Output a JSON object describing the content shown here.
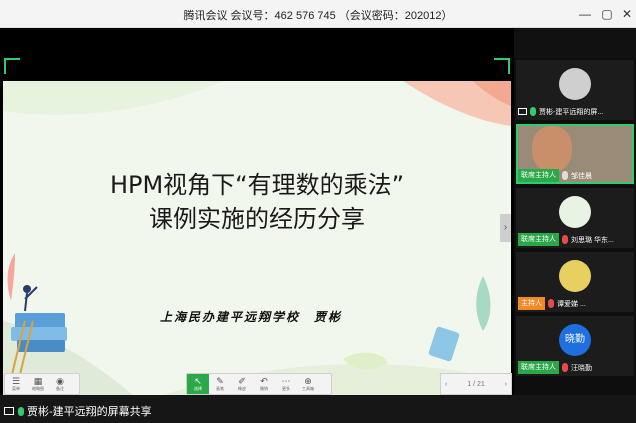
{
  "window": {
    "title": "腾讯会议 会议号：462 576 745 （会议密码：202012）",
    "controls": [
      "minimize-icon",
      "restore-icon",
      "close-icon"
    ]
  },
  "slide": {
    "title_line1": "HPM视角下“有理数的乘法”",
    "title_line2": "课例实施的经历分享",
    "author": "上海民办建平远翔学校　贾彬"
  },
  "toolbar_left": [
    {
      "icon": "menu-icon",
      "label": "菜单"
    },
    {
      "icon": "thumbnail-icon",
      "label": "缩略图"
    },
    {
      "icon": "notes-icon",
      "label": "备注"
    }
  ],
  "toolbar_center": [
    {
      "icon": "select-icon",
      "label": "选择",
      "active": true
    },
    {
      "icon": "pen-icon",
      "label": "画笔",
      "active": false
    },
    {
      "icon": "eraser-icon",
      "label": "橡皮",
      "active": false
    },
    {
      "icon": "undo-icon",
      "label": "撤销",
      "active": false
    },
    {
      "icon": "more-icon",
      "label": "更多",
      "active": false
    },
    {
      "icon": "tools-icon",
      "label": "工具箱",
      "active": false
    }
  ],
  "pager": {
    "prev": "‹",
    "text": "1 / 21",
    "next": "›"
  },
  "participants": [
    {
      "name": "贾彬-建平远翔的屏...",
      "role": "",
      "avatar_color": "#cfcfcf",
      "active": false
    },
    {
      "name": "邹佳晨",
      "role": "联席主持人",
      "avatar_color": "#7a5a3a",
      "active": true
    },
    {
      "name": "刘思璐 华东...",
      "role": "联席主持人",
      "avatar_color": "#e8f3e4",
      "active": false
    },
    {
      "name": "谭爱娣 ...",
      "role": "主持人",
      "role_color": "orange",
      "avatar_color": "#e8d060",
      "active": false
    },
    {
      "name": "汪晓勤",
      "role": "联席主持人",
      "avatar_text": "晓勤",
      "avatar_color": "#1e6fe0",
      "active": false
    }
  ],
  "bottom": {
    "share_text": "贾彬-建平远翔的屏幕共享"
  }
}
